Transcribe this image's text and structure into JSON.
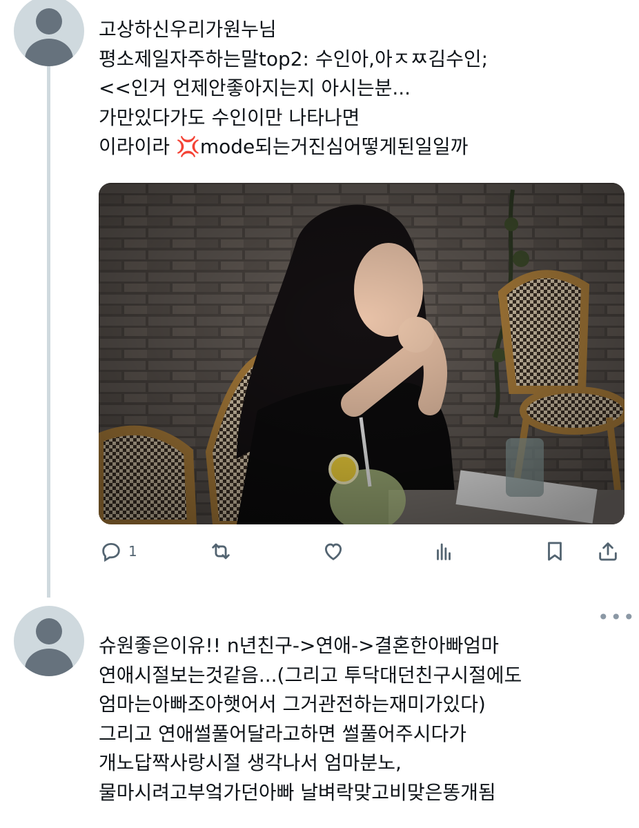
{
  "tweet1": {
    "lines": [
      "고상하신우리가원누님",
      "평소제일자주하는말top2: 수인아,아ㅈㅉ김수인;",
      "<<인거 언제안좋아지는지 아시는분...",
      "가만있다가도 수인이만 나타나면"
    ],
    "line5_before": "이라이라 ",
    "line5_emoji": "💢",
    "line5_after": "mode되는거진심어떻게된일일까",
    "reply_count": "1"
  },
  "tweet2": {
    "lines": [
      "슈원좋은이유!! n년친구->연애->결혼한아빠엄마",
      "연애시절보는것같음...(그리고 투닥대던친구시절에도",
      "엄마는아빠조아햇어서 그거관전하는재미가있다)",
      "그리고 연애썰풀어달라고하면 썰풀어주시다가",
      "개노답짝사랑시절 생각나서 엄마분노,",
      "물마시려고부엌가던아빠 날벼락맞고비맞은똥개됨"
    ]
  },
  "more_label": "•••"
}
